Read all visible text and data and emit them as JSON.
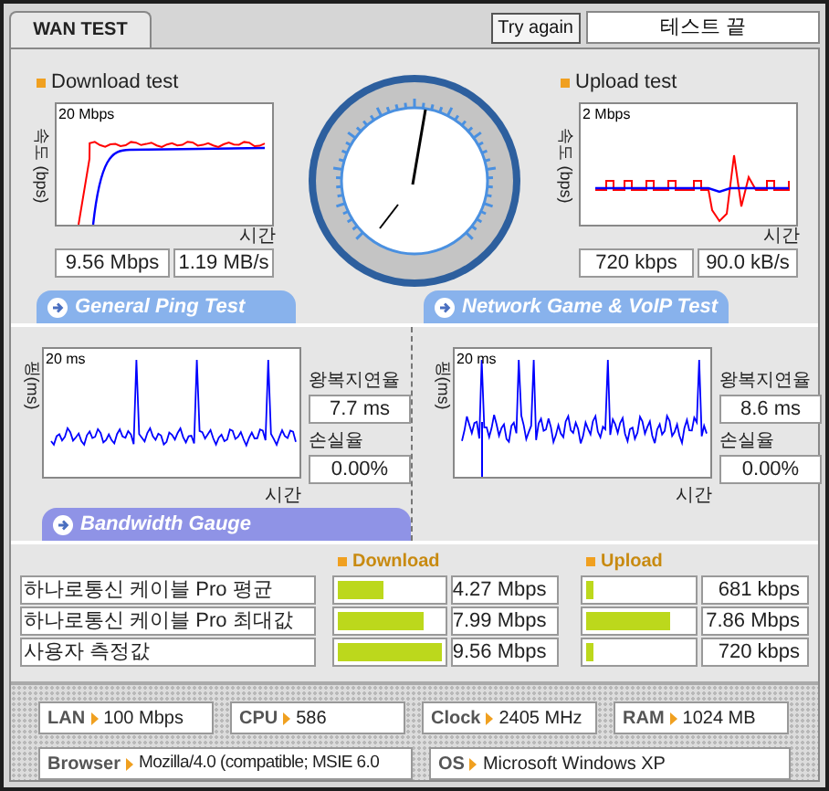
{
  "tab": {
    "label": "WAN TEST",
    "selected": true
  },
  "try_again": "Try again",
  "status": "테스트 끝",
  "tests": [
    {
      "title": "Download test",
      "ylabel": "속도 (bps)",
      "scale": "20 Mbps",
      "xlabel": "시간",
      "readings": [
        "9.56 Mbps",
        "1.19 MB/s"
      ]
    },
    {
      "title": "Upload test",
      "ylabel": "속도 (bps)",
      "scale": "2 Mbps",
      "xlabel": "시간",
      "readings": [
        "720 kbps",
        "90.0 kB/s"
      ]
    }
  ],
  "section_tabs": [
    "General Ping Test",
    "Network Game & VoIP Test"
  ],
  "ping": [
    {
      "ylabel": "핑(ms)",
      "scale": "20 ms",
      "xlabel": "시간",
      "latency_label": "왕복지연율",
      "latency": "7.7 ms",
      "loss_label": "손실율",
      "loss": "0.00%"
    },
    {
      "ylabel": "핑(ms)",
      "scale": "20 ms",
      "xlabel": "시간",
      "latency_label": "왕복지연율",
      "latency": "8.6 ms",
      "loss_label": "손실율",
      "loss": "0.00%"
    }
  ],
  "bandwidth": {
    "title": "Bandwidth Gauge",
    "download_label": "Download",
    "upload_label": "Upload",
    "rows": [
      {
        "name": "하나로통신 케이블 Pro 평균",
        "download": {
          "level": 0.44,
          "reading": "4.27 Mbps"
        },
        "upload": {
          "level": 0.07,
          "reading": "681 kbps"
        }
      },
      {
        "name": "하나로통신 케이블 Pro 최대값",
        "download": {
          "level": 0.83,
          "reading": "7.99 Mbps"
        },
        "upload": {
          "level": 0.8,
          "reading": "7.86 Mbps"
        }
      },
      {
        "name": "사용자 측정값",
        "download": {
          "level": 1.0,
          "reading": "9.56 Mbps"
        },
        "upload": {
          "level": 0.07,
          "reading": "720 kbps"
        }
      }
    ]
  },
  "system": [
    [
      {
        "label": "LAN",
        "value": "100 Mbps"
      },
      {
        "label": "CPU",
        "value": "586"
      },
      {
        "label": "Clock",
        "value": "2405 MHz"
      },
      {
        "label": "RAM",
        "value": "1024 MB"
      }
    ],
    [
      {
        "label": "Browser",
        "value": "Mozilla/4.0 (compatible; MSIE 6.0"
      },
      {
        "label": "OS",
        "value": "Microsoft Windows XP"
      }
    ]
  ]
}
